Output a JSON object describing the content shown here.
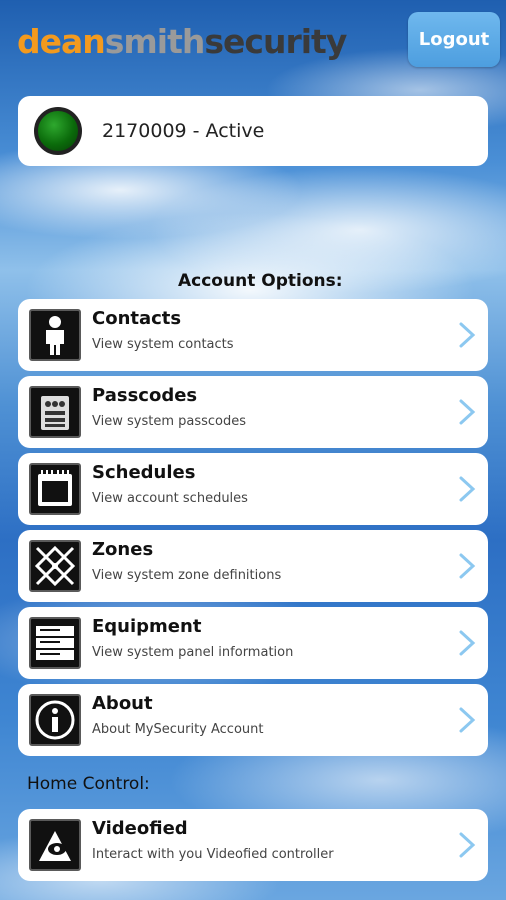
{
  "brand": {
    "part1": "dean",
    "part2": "smith",
    "part3": "security"
  },
  "header": {
    "logout_label": "Logout"
  },
  "status": {
    "text": "2170009 - Active"
  },
  "sections": {
    "account_options": "Account Options:",
    "home_control": "Home Control:"
  },
  "options": [
    {
      "title": "Contacts",
      "subtitle": "View system contacts",
      "icon": "person-icon"
    },
    {
      "title": "Passcodes",
      "subtitle": "View system passcodes",
      "icon": "keypad-icon"
    },
    {
      "title": "Schedules",
      "subtitle": "View account schedules",
      "icon": "calendar-icon"
    },
    {
      "title": "Zones",
      "subtitle": "View system zone definitions",
      "icon": "zones-icon"
    },
    {
      "title": "Equipment",
      "subtitle": "View system panel information",
      "icon": "equipment-icon"
    },
    {
      "title": "About",
      "subtitle": "About MySecurity Account",
      "icon": "info-icon"
    }
  ],
  "home_options": [
    {
      "title": "Videofied",
      "subtitle": "Interact with you Videofied controller",
      "icon": "videofied-icon"
    }
  ],
  "colors": {
    "brand_orange": "#f39a1e",
    "logout_blue": "#5aa8e6",
    "status_green": "#1a8a1a",
    "chevron": "#8cc8f0"
  }
}
